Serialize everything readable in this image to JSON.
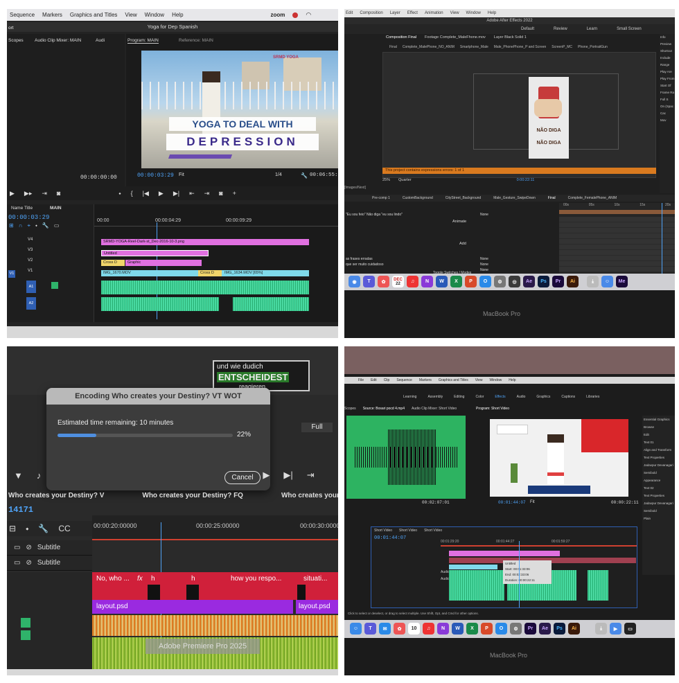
{
  "q1": {
    "menu": [
      "Sequence",
      "Markers",
      "Graphics and Titles",
      "View",
      "Window",
      "Help"
    ],
    "menu_right": "zoom",
    "window_title": "Yoga for Dep Spanish",
    "left_label": "ort",
    "source_tabs": [
      "Scopes",
      "Audio Clip Mixer: MAIN",
      "Audi"
    ],
    "program_tab": "Program: MAIN",
    "reference_tab": "Reference: MAIN",
    "video_title_1": "YOGA TO DEAL WITH",
    "video_title_2": "DEPRESSION",
    "logo_text": "SRMD YOGA",
    "left_timecode": "00:00:00:00",
    "playhead_tc": "00:00:03:29",
    "fit": "Fit",
    "fraction": "1/4",
    "duration_tc": "00:06:55:01",
    "project_tab": "Name Title",
    "seq_tab": "MAIN",
    "seq_tc": "00:00:03:29",
    "ruler": [
      "00:00",
      "00:00:04:29",
      "00:00:09:29"
    ],
    "tracks_v": [
      "V4",
      "V3",
      "V2",
      "V1"
    ],
    "tracks_a": [
      "A1",
      "A2",
      "A3"
    ],
    "clips": {
      "pink_main": "SRMD-YOGA-Reel-Dark-st_Dec-2016-10-3.png",
      "untitled": "Untitled",
      "graphic": "Graphic",
      "img1": "IMG_1670.MOV",
      "img2": "IMG_1634.MOV [65%]",
      "cross1": "Cross D",
      "cross2": "Cross D"
    }
  },
  "q2": {
    "menu": [
      "Edit",
      "Composition",
      "Layer",
      "Effect",
      "Animation",
      "View",
      "Window",
      "Help"
    ],
    "app_title": "Adobe After Effects 2022",
    "workspaces": [
      "Default",
      "Review",
      "Learn",
      "Small Screen"
    ],
    "comp_tab": "Composition Final",
    "footage_tab": "Footage Complete_MaleFhone.mov",
    "layer_tab": "Layer Black Solid 1",
    "breadcrumbs": [
      "Final",
      "Complete_MalePhone_NO_ANIM",
      "Smartphone_Male",
      "Male_PhonePhone_P and Screen",
      "ScreenP_MC",
      "Phone_PortraitGun"
    ],
    "phone_text_1": "NÃO DIGA",
    "phone_text_2": "NÃO DIGA",
    "warning": "This project contains expressions errors: 1 of 1",
    "zoom": "25%",
    "quality": "Quarter",
    "timecode": "0:00:22:11",
    "layer_tabs": [
      "Pre-comp 1",
      "CustomBackground",
      "CityStreet_Background",
      "Male_Gesture_SwipeDown",
      "Final",
      "Complete_FemalePhone_ANIM"
    ],
    "layer_rows": [
      "\"Eu sou feio\" Não diga \"eu sou lindo\"",
      "Animate",
      "Add",
      "as frases erradas",
      "que ser muito cuidadoso"
    ],
    "parent_none": [
      "None",
      "None",
      "None",
      "None"
    ],
    "toggle_label": "Toggle Switches / Modes",
    "timeline_marks": [
      "00s",
      "05s",
      "10s",
      "15s",
      "20s"
    ],
    "images_label": "[Images/Next]",
    "right_labels": [
      "Info",
      "Preview",
      "Shortcut",
      "Include",
      "Range",
      "Play Are",
      "Play From",
      "Start Of",
      "Frame Ra",
      "Full S",
      "On (Spac",
      "Cac",
      "Mov"
    ],
    "dock_date": "22",
    "dock_month": "DEC",
    "dock_apps": [
      "Ae",
      "Ps",
      "Pr",
      "Ai",
      "Me"
    ],
    "laptop": "MacBook Pro"
  },
  "q3": {
    "overlay_1": "und wie dudich",
    "overlay_2": "ENTSCHEIDEST",
    "overlay_3": "reagieren.",
    "dialog_title": "Encoding Who creates your Destiny? VT WOT",
    "estimate": "Estimated time remaining: 10 minutes",
    "progress": 0.22,
    "progress_label": "22%",
    "cancel": "Cancel",
    "full": "Full",
    "seq_names": [
      "Who creates your Destiny? V",
      "Who creates your Destiny? FQ",
      "Who creates your Destiny? V"
    ],
    "seq_tc": "14171",
    "ruler": [
      "00:00:20:00000",
      "00:00:25:00000",
      "00:00:30:00000"
    ],
    "subtitle_1": "Subtitle",
    "subtitle_2": "Subtitle",
    "clip_labels": [
      "No, who ...",
      "h",
      "h",
      "how you respo...",
      "situati..."
    ],
    "fx": "fx",
    "layout_1": "layout.psd",
    "layout_2": "layout.psd",
    "tooltip": "Adobe Premiere Pro 2025"
  },
  "q4": {
    "menu": [
      "File",
      "Edit",
      "Clip",
      "Sequence",
      "Markers",
      "Graphics and Titles",
      "View",
      "Window",
      "Help"
    ],
    "workspaces": [
      "Learning",
      "Assembly",
      "Editing",
      "Color",
      "Effects",
      "Audio",
      "Graphics",
      "Captions",
      "Libraries"
    ],
    "source_tabs": [
      "Scopes",
      "Source: Bosari pocd 4.mp4",
      "Audio Clip Mixer: Short Video"
    ],
    "program_tab": "Program: Short Video",
    "src_tc": "00:02:07:01",
    "prog_tc": "00:01:44:07",
    "prog_fit": "Fit",
    "prog_dur": "00:00:22:11",
    "seq_tabs": [
      "Short Video",
      "Short Video",
      "Short Video"
    ],
    "seq_tc": "00:01:44:07",
    "ruler": [
      "00:01:29:20",
      "00:01:44:27",
      "00:01:59:27"
    ],
    "tooltip_lines": [
      "Untitled",
      "Start: 00:01:33:06",
      "End: 00:02:33:06",
      "Duration: 00:00:22:11"
    ],
    "audio": [
      "Audio 1",
      "Audio 2"
    ],
    "status": "Click to select or deselect, or drag to select multiple. Use Shift, Opt, and Cmd for other options.",
    "right_labels": [
      "Essential Graphics",
      "Browse",
      "Edit",
      "Text 01",
      "Align and Transform",
      "Text Properties",
      "Appearance",
      "Stroke",
      "Shadow",
      "Text 02",
      "Text Properties"
    ],
    "font_items": [
      "Jadavpur Devanagari",
      "Semibold",
      "Semibold",
      "Plain",
      "Jadavpur Devanagari"
    ],
    "dock_date": "10",
    "dock_apps": [
      "Pr",
      "Ae",
      "Ps",
      "Ai"
    ],
    "laptop": "MacBook Pro"
  }
}
